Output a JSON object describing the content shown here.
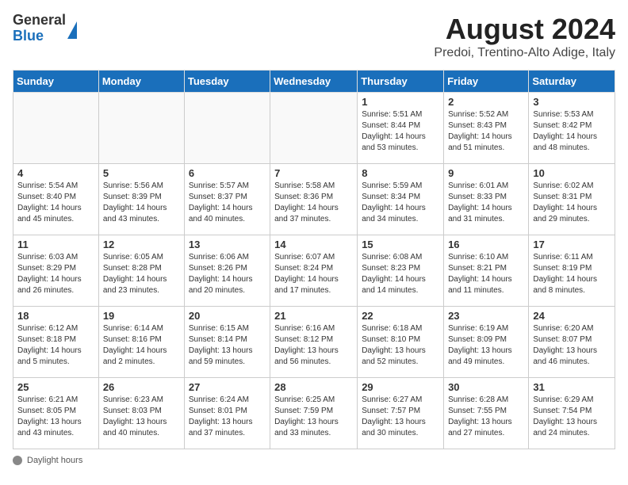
{
  "header": {
    "logo": {
      "general": "General",
      "blue": "Blue"
    },
    "title": "August 2024",
    "subtitle": "Predoi, Trentino-Alto Adige, Italy"
  },
  "calendar": {
    "weekdays": [
      "Sunday",
      "Monday",
      "Tuesday",
      "Wednesday",
      "Thursday",
      "Friday",
      "Saturday"
    ],
    "weeks": [
      [
        {
          "day": "",
          "info": ""
        },
        {
          "day": "",
          "info": ""
        },
        {
          "day": "",
          "info": ""
        },
        {
          "day": "",
          "info": ""
        },
        {
          "day": "1",
          "info": "Sunrise: 5:51 AM\nSunset: 8:44 PM\nDaylight: 14 hours\nand 53 minutes."
        },
        {
          "day": "2",
          "info": "Sunrise: 5:52 AM\nSunset: 8:43 PM\nDaylight: 14 hours\nand 51 minutes."
        },
        {
          "day": "3",
          "info": "Sunrise: 5:53 AM\nSunset: 8:42 PM\nDaylight: 14 hours\nand 48 minutes."
        }
      ],
      [
        {
          "day": "4",
          "info": "Sunrise: 5:54 AM\nSunset: 8:40 PM\nDaylight: 14 hours\nand 45 minutes."
        },
        {
          "day": "5",
          "info": "Sunrise: 5:56 AM\nSunset: 8:39 PM\nDaylight: 14 hours\nand 43 minutes."
        },
        {
          "day": "6",
          "info": "Sunrise: 5:57 AM\nSunset: 8:37 PM\nDaylight: 14 hours\nand 40 minutes."
        },
        {
          "day": "7",
          "info": "Sunrise: 5:58 AM\nSunset: 8:36 PM\nDaylight: 14 hours\nand 37 minutes."
        },
        {
          "day": "8",
          "info": "Sunrise: 5:59 AM\nSunset: 8:34 PM\nDaylight: 14 hours\nand 34 minutes."
        },
        {
          "day": "9",
          "info": "Sunrise: 6:01 AM\nSunset: 8:33 PM\nDaylight: 14 hours\nand 31 minutes."
        },
        {
          "day": "10",
          "info": "Sunrise: 6:02 AM\nSunset: 8:31 PM\nDaylight: 14 hours\nand 29 minutes."
        }
      ],
      [
        {
          "day": "11",
          "info": "Sunrise: 6:03 AM\nSunset: 8:29 PM\nDaylight: 14 hours\nand 26 minutes."
        },
        {
          "day": "12",
          "info": "Sunrise: 6:05 AM\nSunset: 8:28 PM\nDaylight: 14 hours\nand 23 minutes."
        },
        {
          "day": "13",
          "info": "Sunrise: 6:06 AM\nSunset: 8:26 PM\nDaylight: 14 hours\nand 20 minutes."
        },
        {
          "day": "14",
          "info": "Sunrise: 6:07 AM\nSunset: 8:24 PM\nDaylight: 14 hours\nand 17 minutes."
        },
        {
          "day": "15",
          "info": "Sunrise: 6:08 AM\nSunset: 8:23 PM\nDaylight: 14 hours\nand 14 minutes."
        },
        {
          "day": "16",
          "info": "Sunrise: 6:10 AM\nSunset: 8:21 PM\nDaylight: 14 hours\nand 11 minutes."
        },
        {
          "day": "17",
          "info": "Sunrise: 6:11 AM\nSunset: 8:19 PM\nDaylight: 14 hours\nand 8 minutes."
        }
      ],
      [
        {
          "day": "18",
          "info": "Sunrise: 6:12 AM\nSunset: 8:18 PM\nDaylight: 14 hours\nand 5 minutes."
        },
        {
          "day": "19",
          "info": "Sunrise: 6:14 AM\nSunset: 8:16 PM\nDaylight: 14 hours\nand 2 minutes."
        },
        {
          "day": "20",
          "info": "Sunrise: 6:15 AM\nSunset: 8:14 PM\nDaylight: 13 hours\nand 59 minutes."
        },
        {
          "day": "21",
          "info": "Sunrise: 6:16 AM\nSunset: 8:12 PM\nDaylight: 13 hours\nand 56 minutes."
        },
        {
          "day": "22",
          "info": "Sunrise: 6:18 AM\nSunset: 8:10 PM\nDaylight: 13 hours\nand 52 minutes."
        },
        {
          "day": "23",
          "info": "Sunrise: 6:19 AM\nSunset: 8:09 PM\nDaylight: 13 hours\nand 49 minutes."
        },
        {
          "day": "24",
          "info": "Sunrise: 6:20 AM\nSunset: 8:07 PM\nDaylight: 13 hours\nand 46 minutes."
        }
      ],
      [
        {
          "day": "25",
          "info": "Sunrise: 6:21 AM\nSunset: 8:05 PM\nDaylight: 13 hours\nand 43 minutes."
        },
        {
          "day": "26",
          "info": "Sunrise: 6:23 AM\nSunset: 8:03 PM\nDaylight: 13 hours\nand 40 minutes."
        },
        {
          "day": "27",
          "info": "Sunrise: 6:24 AM\nSunset: 8:01 PM\nDaylight: 13 hours\nand 37 minutes."
        },
        {
          "day": "28",
          "info": "Sunrise: 6:25 AM\nSunset: 7:59 PM\nDaylight: 13 hours\nand 33 minutes."
        },
        {
          "day": "29",
          "info": "Sunrise: 6:27 AM\nSunset: 7:57 PM\nDaylight: 13 hours\nand 30 minutes."
        },
        {
          "day": "30",
          "info": "Sunrise: 6:28 AM\nSunset: 7:55 PM\nDaylight: 13 hours\nand 27 minutes."
        },
        {
          "day": "31",
          "info": "Sunrise: 6:29 AM\nSunset: 7:54 PM\nDaylight: 13 hours\nand 24 minutes."
        }
      ]
    ]
  },
  "footer": {
    "note": "Daylight hours"
  }
}
